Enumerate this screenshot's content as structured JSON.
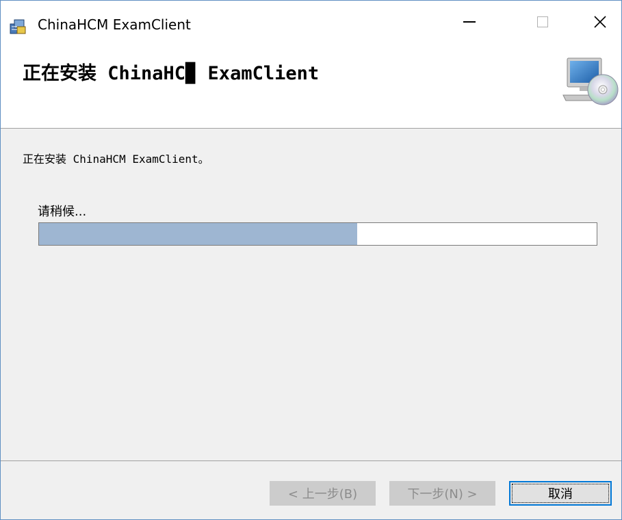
{
  "window": {
    "title": "ChinaHCM ExamClient"
  },
  "icons": {
    "app": "installer-package-icon",
    "minimize": "minimize-icon",
    "maximize": "maximize-icon",
    "close": "close-icon",
    "setup": "computer-cd-icon"
  },
  "banner": {
    "title": "正在安装 ChinaHC▉ ExamClient"
  },
  "body": {
    "status": "正在安装 ChinaHCM ExamClient。",
    "wait_label": "请稍候...",
    "progress_fraction": 0.57
  },
  "buttons": {
    "back": "< 上一步(B)",
    "next": "下一步(N) >",
    "cancel": "取消"
  },
  "colors": {
    "progress_fill": "#9eb6d2",
    "focus_border": "#0078d7"
  }
}
